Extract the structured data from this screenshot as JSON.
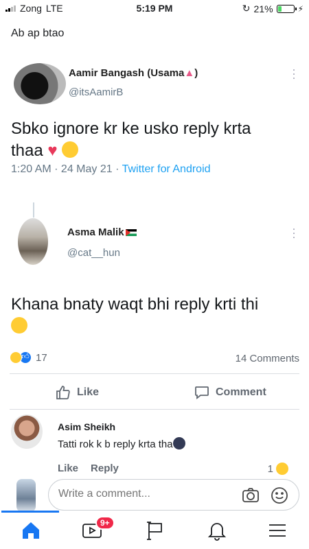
{
  "status": {
    "carrier": "Zong",
    "network": "LTE",
    "time": "5:19 PM",
    "battery": "21%",
    "battery_level": 0.21
  },
  "post": {
    "text": "Ab ap btao"
  },
  "tweet1": {
    "name": "Aamir Bangash (Usama",
    "name_close": ")",
    "handle": "@itsAamirB",
    "body_line1": "Sbko ignore kr ke usko reply krta",
    "body_line2": "thaa",
    "time": "1:20 AM",
    "date": "24 May 21",
    "source": "Twitter for Android"
  },
  "tweet2": {
    "name": "Asma Malik",
    "handle": "@cat__hun",
    "body": "Khana bnaty waqt bhi reply krti thi"
  },
  "reactions": {
    "count": "17",
    "comments": "14 Comments"
  },
  "actions": {
    "like": "Like",
    "comment": "Comment"
  },
  "comment": {
    "author": "Asim Sheikh",
    "text": "Tatti rok k b reply krta tha",
    "like": "Like",
    "reply": "Reply",
    "reaction_count": "1"
  },
  "composer": {
    "placeholder": "Write a comment..."
  },
  "tabs": {
    "video_badge": "9+"
  },
  "colors": {
    "accent": "#1877f2",
    "badge": "#f02849",
    "twitter_link": "#1da1f2"
  }
}
